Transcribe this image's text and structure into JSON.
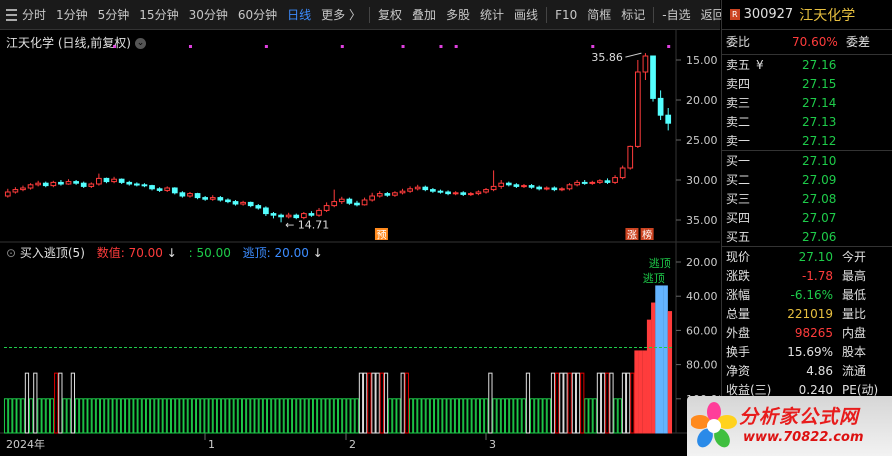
{
  "toolbar": {
    "menu_icon": "menu-icon",
    "items": [
      "分时",
      "1分钟",
      "5分钟",
      "15分钟",
      "30分钟",
      "60分钟",
      "日线",
      "更多 〉",
      "复权",
      "叠加",
      "多股",
      "统计",
      "画线",
      "F10",
      "简框",
      "标记",
      "-自选",
      "返回"
    ],
    "active": "日线"
  },
  "main_chart": {
    "title": "江天化学 (日线,前复权)",
    "high_label": "35.86",
    "low_label": "14.71",
    "badges": [
      "预",
      "涨",
      "榜"
    ],
    "y_ticks": [
      "35.00",
      "30.00",
      "25.00",
      "20.00",
      "15.00"
    ]
  },
  "indicator": {
    "name": "买入逃顶(5)",
    "value_label": "数值: 70.00",
    "mid_label": ": 50.00",
    "top_label": "逃顶: 20.00",
    "annotation": "逃顶",
    "annotation_top": "逃顶",
    "y_ticks": [
      "100.00",
      "80.00",
      "60.00",
      "40.00",
      "20.00"
    ]
  },
  "x_axis": {
    "labels": [
      "2024年",
      "1",
      "2",
      "3"
    ]
  },
  "quote": {
    "badge": "R",
    "code": "300927",
    "name": "江天化学",
    "ratio_label": "委比",
    "ratio_value": "70.60%",
    "diff_label": "委差",
    "sells": [
      {
        "label": "卖五",
        "price": "27.16"
      },
      {
        "label": "卖四",
        "price": "27.15"
      },
      {
        "label": "卖三",
        "price": "27.14"
      },
      {
        "label": "卖二",
        "price": "27.13"
      },
      {
        "label": "卖一",
        "price": "27.12"
      }
    ],
    "buys": [
      {
        "label": "买一",
        "price": "27.10"
      },
      {
        "label": "买二",
        "price": "27.09"
      },
      {
        "label": "买三",
        "price": "27.08"
      },
      {
        "label": "买四",
        "price": "27.07"
      },
      {
        "label": "买五",
        "price": "27.06"
      }
    ],
    "stats": [
      {
        "l1": "现价",
        "v1": "27.10",
        "l2": "今开",
        "v2": ""
      },
      {
        "l1": "涨跌",
        "v1": "-1.78",
        "l2": "最高",
        "v2": ""
      },
      {
        "l1": "涨幅",
        "v1": "-6.16%",
        "l2": "最低",
        "v2": ""
      },
      {
        "l1": "总量",
        "v1": "221019",
        "l2": "量比",
        "v2": ""
      },
      {
        "l1": "外盘",
        "v1": "98265",
        "l2": "内盘",
        "v2": ""
      },
      {
        "l1": "换手",
        "v1": "15.69%",
        "l2": "股本",
        "v2": ""
      },
      {
        "l1": "净资",
        "v1": "4.86",
        "l2": "流通",
        "v2": ""
      },
      {
        "l1": "收益(三)",
        "v1": "0.240",
        "l2": "PE(动)",
        "v2": ""
      }
    ]
  },
  "watermark": {
    "title": "分析家公式网",
    "url": "www.70822.com"
  },
  "colors": {
    "up": "#ff3c3c",
    "down": "#54ffff",
    "mid_line": "#1ecc4a",
    "accent": "#3c8cff",
    "background": "#000000"
  },
  "chart_data": [
    {
      "type": "candlestick",
      "title": "江天化学 (日线,前复权)",
      "x_axis_labels": [
        "2024年",
        "1",
        "2",
        "3"
      ],
      "ylim": [
        13,
        37
      ],
      "y_ticks": [
        15,
        20,
        25,
        30,
        35
      ],
      "annotations": [
        {
          "text": "35.86",
          "kind": "high"
        },
        {
          "text": "14.71",
          "kind": "low"
        }
      ],
      "candles": [
        [
          18.0,
          18.5,
          17.8,
          18.9
        ],
        [
          18.5,
          18.8,
          18.3,
          19.1
        ],
        [
          18.8,
          19.0,
          18.6,
          19.3
        ],
        [
          19.0,
          19.4,
          18.8,
          19.6
        ],
        [
          19.4,
          19.6,
          19.2,
          19.9
        ],
        [
          19.6,
          19.3,
          19.1,
          19.8
        ],
        [
          19.3,
          19.7,
          19.1,
          19.9
        ],
        [
          19.7,
          19.5,
          19.3,
          20.0
        ],
        [
          19.5,
          19.8,
          19.4,
          20.1
        ],
        [
          19.8,
          19.6,
          19.4,
          20.0
        ],
        [
          19.6,
          19.2,
          19.0,
          19.8
        ],
        [
          19.2,
          19.5,
          19.0,
          19.7
        ],
        [
          19.5,
          20.2,
          19.3,
          20.8
        ],
        [
          20.2,
          19.8,
          19.6,
          20.3
        ],
        [
          19.8,
          20.1,
          19.6,
          20.4
        ],
        [
          20.1,
          19.7,
          19.5,
          20.2
        ],
        [
          19.7,
          19.5,
          19.3,
          19.9
        ],
        [
          19.5,
          19.4,
          19.2,
          19.7
        ],
        [
          19.4,
          19.3,
          19.1,
          19.6
        ],
        [
          19.3,
          18.9,
          18.7,
          19.4
        ],
        [
          18.9,
          18.7,
          18.5,
          19.1
        ],
        [
          18.7,
          19.0,
          18.5,
          19.2
        ],
        [
          19.0,
          18.4,
          18.2,
          19.1
        ],
        [
          18.4,
          18.0,
          17.8,
          18.6
        ],
        [
          18.0,
          18.3,
          17.8,
          18.5
        ],
        [
          18.3,
          17.8,
          17.6,
          18.4
        ],
        [
          17.8,
          17.6,
          17.4,
          18.0
        ],
        [
          17.6,
          17.8,
          17.4,
          18.1
        ],
        [
          17.8,
          17.5,
          17.3,
          18.0
        ],
        [
          17.5,
          17.3,
          17.1,
          17.7
        ],
        [
          17.3,
          17.0,
          16.8,
          17.5
        ],
        [
          17.0,
          17.2,
          16.8,
          17.4
        ],
        [
          17.2,
          16.8,
          16.6,
          17.3
        ],
        [
          16.8,
          16.5,
          16.3,
          17.0
        ],
        [
          16.5,
          15.8,
          15.5,
          16.7
        ],
        [
          15.8,
          15.6,
          15.2,
          16.0
        ],
        [
          15.6,
          15.4,
          14.71,
          15.8
        ],
        [
          15.4,
          15.6,
          15.2,
          15.9
        ],
        [
          15.6,
          15.3,
          15.1,
          15.8
        ],
        [
          15.3,
          15.8,
          15.1,
          16.0
        ],
        [
          15.8,
          15.6,
          15.4,
          16.1
        ],
        [
          15.6,
          16.2,
          15.4,
          16.5
        ],
        [
          16.2,
          16.8,
          16.0,
          17.2
        ],
        [
          16.8,
          17.3,
          16.6,
          18.8
        ],
        [
          17.3,
          17.6,
          17.0,
          17.9
        ],
        [
          17.6,
          17.1,
          16.9,
          17.8
        ],
        [
          17.1,
          16.9,
          16.7,
          17.4
        ],
        [
          16.9,
          17.5,
          16.8,
          17.8
        ],
        [
          17.5,
          18.0,
          17.3,
          18.4
        ],
        [
          18.0,
          18.3,
          17.8,
          18.6
        ],
        [
          18.3,
          18.1,
          17.9,
          18.5
        ],
        [
          18.1,
          18.4,
          17.9,
          18.6
        ],
        [
          18.4,
          18.6,
          18.2,
          18.9
        ],
        [
          18.6,
          18.9,
          18.4,
          19.2
        ],
        [
          18.9,
          19.1,
          18.7,
          19.4
        ],
        [
          19.1,
          18.8,
          18.6,
          19.3
        ],
        [
          18.8,
          18.6,
          18.4,
          19.0
        ],
        [
          18.6,
          18.5,
          18.3,
          18.8
        ],
        [
          18.5,
          18.3,
          18.1,
          18.7
        ],
        [
          18.3,
          18.4,
          18.1,
          18.6
        ],
        [
          18.4,
          18.2,
          18.0,
          18.6
        ],
        [
          18.2,
          18.3,
          18.0,
          18.5
        ],
        [
          18.3,
          18.5,
          18.1,
          18.7
        ],
        [
          18.5,
          18.8,
          18.3,
          19.0
        ],
        [
          18.8,
          19.2,
          18.6,
          21.2
        ],
        [
          19.2,
          19.6,
          18.9,
          20.0
        ],
        [
          19.6,
          19.4,
          19.2,
          19.8
        ],
        [
          19.4,
          19.2,
          19.0,
          19.6
        ],
        [
          19.2,
          19.3,
          19.0,
          19.5
        ],
        [
          19.3,
          19.1,
          18.9,
          19.5
        ],
        [
          19.1,
          18.9,
          18.7,
          19.3
        ],
        [
          18.9,
          19.0,
          18.7,
          19.2
        ],
        [
          19.0,
          18.8,
          18.6,
          19.2
        ],
        [
          18.8,
          18.9,
          18.6,
          19.1
        ],
        [
          18.9,
          19.4,
          18.7,
          19.6
        ],
        [
          19.4,
          19.7,
          19.2,
          20.0
        ],
        [
          19.7,
          19.6,
          19.4,
          20.0
        ],
        [
          19.6,
          19.7,
          19.4,
          19.9
        ],
        [
          19.7,
          19.9,
          19.5,
          20.1
        ],
        [
          19.9,
          19.7,
          19.5,
          20.2
        ],
        [
          19.7,
          20.3,
          19.5,
          20.6
        ],
        [
          20.3,
          21.5,
          20.1,
          21.8
        ],
        [
          21.5,
          24.2,
          21.3,
          24.3
        ],
        [
          24.2,
          33.5,
          24.0,
          35.0
        ],
        [
          33.5,
          35.5,
          32.5,
          35.86
        ],
        [
          35.5,
          30.2,
          29.8,
          34.8
        ],
        [
          30.2,
          28.1,
          27.5,
          31.2
        ],
        [
          28.1,
          27.1,
          26.2,
          29.0
        ]
      ]
    },
    {
      "type": "bar",
      "title": "买入逃顶(5)",
      "ylim": [
        0,
        100
      ],
      "y_ticks": [
        20,
        40,
        60,
        80,
        100
      ],
      "reference_lines": [
        {
          "value": 50,
          "label": "50.00"
        }
      ],
      "series": [
        {
          "name": "数值",
          "values": [
            20,
            20,
            20,
            20,
            20,
            35,
            20,
            35,
            20,
            20,
            20,
            20,
            35,
            35,
            20,
            20,
            35,
            20,
            20,
            20,
            20,
            20,
            20,
            20,
            20,
            20,
            20,
            20,
            20,
            20,
            20,
            20,
            20,
            20,
            20,
            20,
            20,
            20,
            20,
            20,
            20,
            20,
            20,
            20,
            20,
            20,
            20,
            20,
            20,
            20,
            20,
            20,
            20,
            20,
            20,
            20,
            20,
            20,
            20,
            20,
            20,
            20,
            20,
            20,
            20,
            20,
            20,
            20,
            20,
            20,
            20,
            20,
            20,
            20,
            20,
            20,
            20,
            20,
            20,
            20,
            20,
            20,
            20,
            20,
            20,
            35,
            35,
            35,
            35,
            35,
            35,
            35,
            20,
            20,
            20,
            35,
            35,
            20,
            20,
            20,
            20,
            20,
            20,
            20,
            20,
            20,
            20,
            20,
            20,
            20,
            20,
            20,
            20,
            20,
            20,
            20,
            35,
            20,
            20,
            20,
            20,
            20,
            20,
            20,
            20,
            35,
            20,
            20,
            20,
            20,
            20,
            35,
            35,
            35,
            35,
            35,
            35,
            35,
            35,
            20,
            20,
            20,
            35,
            35,
            35,
            35,
            20,
            20,
            35,
            35,
            35,
            48,
            48,
            48,
            66,
            76,
            86,
            86,
            86,
            71
          ]
        }
      ],
      "bar_styles": "white=unfilled, green=low, red=mid, blue=top"
    }
  ]
}
